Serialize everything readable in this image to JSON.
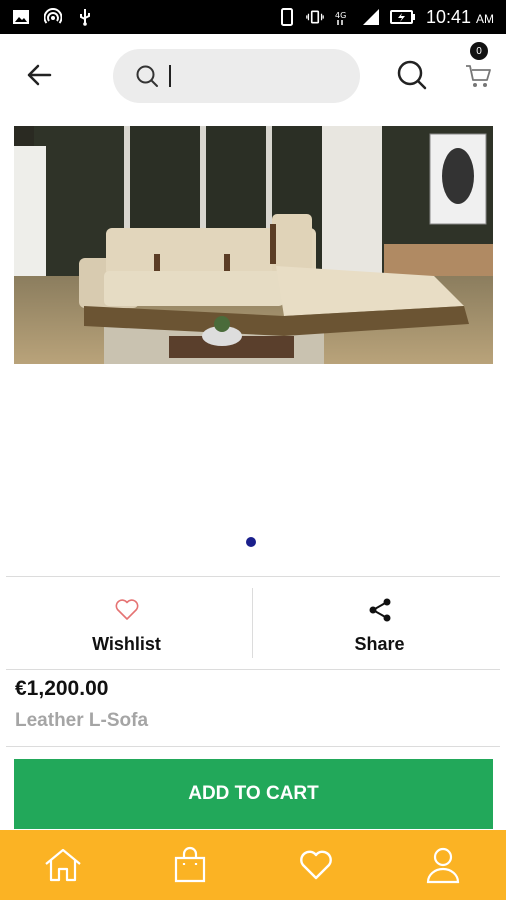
{
  "status_bar": {
    "time": "10:41",
    "ampm": "AM"
  },
  "search": {
    "value": "",
    "placeholder": ""
  },
  "cart": {
    "badge_count": "0"
  },
  "carousel": {
    "active_index": 0
  },
  "actions": {
    "wishlist_label": "Wishlist",
    "share_label": "Share"
  },
  "product": {
    "price": "€1,200.00",
    "name": "Leather L-Sofa"
  },
  "buttons": {
    "add_to_cart": "ADD TO CART"
  },
  "colors": {
    "accent_green": "#22a85a",
    "nav_orange": "#fbb324",
    "dot_active": "#1a1f8c",
    "wishlist_heart": "#e57373"
  },
  "bottom_nav": [
    "home-icon",
    "shopping-bag-icon",
    "heart-icon",
    "user-icon"
  ]
}
